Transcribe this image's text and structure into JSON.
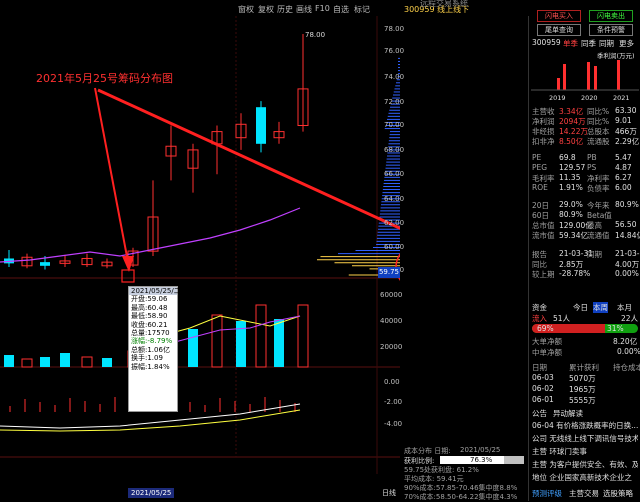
{
  "topbar": {
    "items": [
      "窗权",
      "复权",
      "历史",
      "画线",
      "F10",
      "自选",
      "标记"
    ],
    "stock_tag": "300959 线上线下",
    "window_title": "远程交易系统"
  },
  "chart": {
    "annotation": "2021年5月25号筹码分布图",
    "price_labels": [
      "78.00",
      "76.00",
      "74.00",
      "72.00",
      "70.00",
      "68.00",
      "66.00",
      "64.00",
      "62.00",
      "60.00",
      "58.00"
    ],
    "high_label": "78.00",
    "current_price_tag": "59.75",
    "vol_labels": [
      "60000",
      "40000",
      "20000"
    ],
    "macd_labels": [
      "0.00",
      "-2.00",
      "-4.00"
    ],
    "tooltip": {
      "date": "2021/05/25/二",
      "rows": [
        "开盘:59.06",
        "最高:60.48",
        "最低:58.90",
        "收盘:60.21",
        "总量:17570",
        "涨幅:-8.79%",
        "总额:1.06亿",
        "换手:1.09",
        "振幅:1.84%"
      ]
    },
    "date_label": "2021/05/25",
    "bottom_mode": "日线",
    "accent_red": "#ff2020",
    "accent_green": "#20ff20",
    "up_color": "#ff3030",
    "down_color": "#00e5ff"
  },
  "distribution": {
    "title": "成本分布 日期:",
    "date": "2021/05/25",
    "rows": [
      "获利比例:",
      "59.75处获利盘: 61.2%",
      "平均成本: 59.41元",
      "90%成本:57.85-70.46集中度8.8%",
      "70%成本:58.50-64.22集中度4.3%"
    ],
    "profit_value": "76.3%"
  },
  "right": {
    "buttons": [
      "闪电买入",
      "闪电卖出",
      "尾单查询",
      "条件预警"
    ],
    "code": "300959",
    "tabs": [
      "单季",
      "同季",
      "同期",
      "更多"
    ],
    "chart_title": "季利润(万元)",
    "years": [
      "2019",
      "2020",
      "2021"
    ],
    "fin": [
      [
        "主营收",
        "3.34亿",
        "同比%",
        "63.30"
      ],
      [
        "净利润",
        "2094万",
        "同比%",
        "9.01"
      ],
      [
        "非经损",
        "14.22万",
        "总股本",
        "466万"
      ],
      [
        "扣非净",
        "8.50亿",
        "流通股",
        "2.29亿"
      ]
    ],
    "val": [
      [
        "PE",
        "69.8",
        "PB",
        "5.47"
      ],
      [
        "PEG",
        "129.57",
        "PS",
        "4.87"
      ],
      [
        "毛利率",
        "11.35",
        "净利率",
        "6.27"
      ],
      [
        "ROE",
        "1.91%",
        "负债率",
        "6.00"
      ]
    ],
    "stats": [
      [
        "20日",
        "29.0%",
        "今年来",
        "80.9%"
      ],
      [
        "60日",
        "80.9%",
        "Beta值",
        ""
      ],
      [
        "总市值",
        "129.00亿",
        "最高",
        "56.50"
      ],
      [
        "流市值",
        "59.34亿",
        "流通值",
        "14.84亿"
      ]
    ],
    "report": [
      [
        "报告",
        "21-03-31",
        "同期",
        "21-03-21"
      ],
      [
        "同比",
        "2.85万",
        "",
        "4.00万"
      ],
      [
        "较上期",
        "-28.78%",
        "",
        "0.00%"
      ]
    ],
    "fund_tabs": [
      "资金",
      "今日",
      "本周",
      "本月"
    ],
    "fund_row": [
      "流入",
      "51人",
      "",
      "22人"
    ],
    "bar_pct": [
      "69%",
      "31%"
    ],
    "big_order": [
      "大单净额",
      "",
      "",
      "8.20亿"
    ],
    "mid_order": [
      "中单净额",
      "",
      "",
      "0.00%"
    ],
    "table_head": [
      "日期",
      "累计获利",
      "持仓成本"
    ],
    "table_rows": [
      [
        "06-03",
        "5070万",
        ""
      ],
      [
        "06-02",
        "1965万",
        ""
      ],
      [
        "06-01",
        "5555万",
        ""
      ]
    ],
    "news_tabs": [
      "公告",
      "异动解读"
    ],
    "news": [
      "06-04 有价格涨跌概率的日换...",
      "公司 无线线上线下调讯信号技术...",
      "主营 环球门卖事",
      "主营 为客户提供安全、有效、及...",
      "地位 企业国家高新技术企业之"
    ],
    "bottom_tabs": [
      "预测评级",
      "主营交易",
      "选股策略"
    ]
  }
}
